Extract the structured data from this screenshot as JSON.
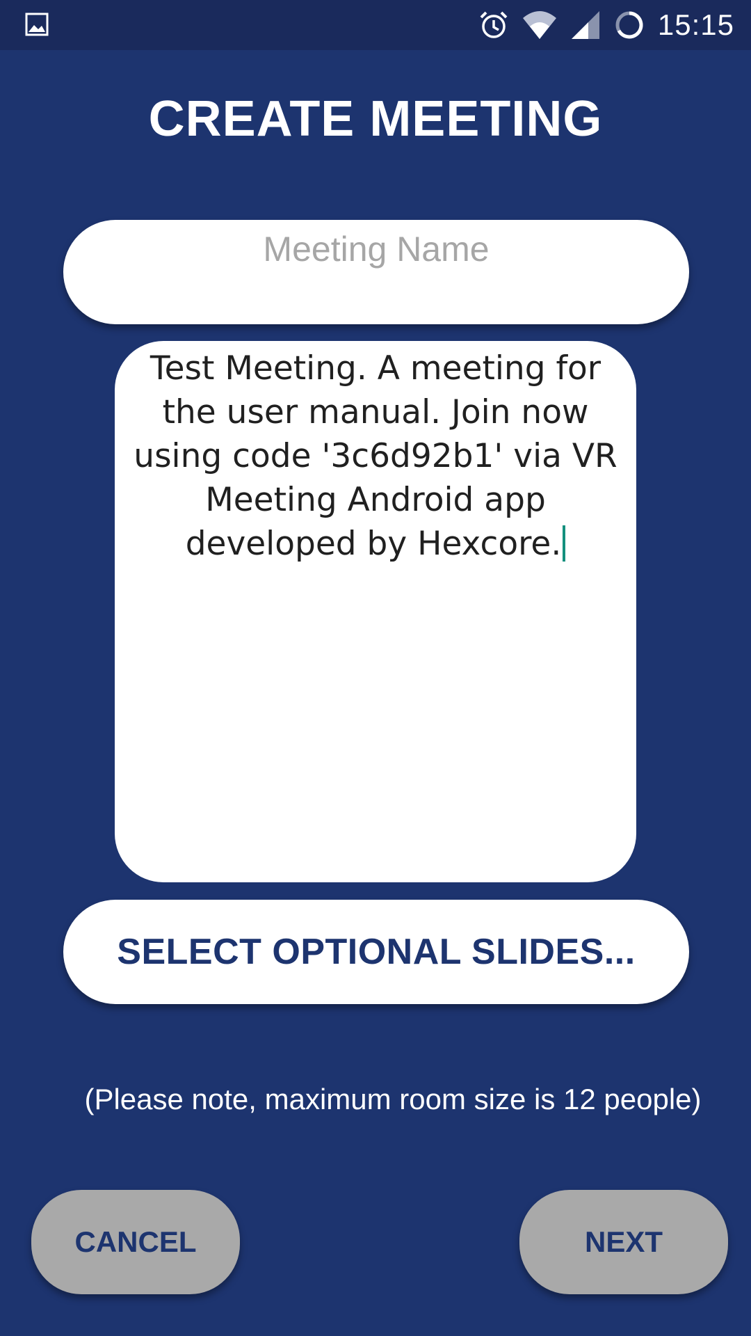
{
  "status_bar": {
    "time": "15:15",
    "left_icon": "image-icon",
    "icons": [
      "alarm-icon",
      "wifi-icon",
      "signal-icon",
      "sync-icon"
    ]
  },
  "screen": {
    "title": "CREATE MEETING"
  },
  "form": {
    "meeting_name_value": "",
    "meeting_name_placeholder": "Meeting Name",
    "description_value": "Test Meeting. A meeting for the user manual. Join now using code '3c6d92b1' via VR Meeting Android app developed by Hexcore.",
    "select_slides_label": "SELECT OPTIONAL SLIDES...",
    "note": "(Please note, maximum room size is 12 people)"
  },
  "actions": {
    "cancel_label": "CANCEL",
    "next_label": "NEXT"
  },
  "colors": {
    "background": "#1d346f",
    "status_bar": "#1a2a5c",
    "button_gray": "#a9a9a9",
    "text_accent": "#1d346f",
    "cursor": "#14907e"
  }
}
